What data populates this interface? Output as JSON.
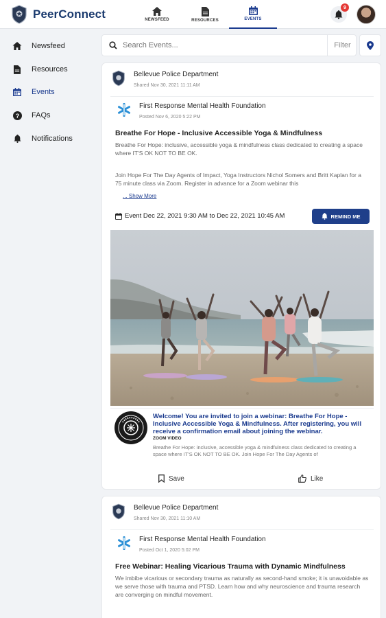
{
  "app": {
    "name": "PeerConnect"
  },
  "topnav": [
    {
      "label": "NEWSFEED",
      "icon": "home-icon",
      "active": false
    },
    {
      "label": "RESOURCES",
      "icon": "file-icon",
      "active": false
    },
    {
      "label": "EVENTS",
      "icon": "calendar-icon",
      "active": true
    }
  ],
  "notifications": {
    "count": "9"
  },
  "sidebar": [
    {
      "label": "Newsfeed",
      "icon": "home-icon"
    },
    {
      "label": "Resources",
      "icon": "file-icon"
    },
    {
      "label": "Events",
      "icon": "calendar-icon",
      "active": true
    },
    {
      "label": "FAQs",
      "icon": "question-circle-icon"
    },
    {
      "label": "Notifications",
      "icon": "bell-icon"
    }
  ],
  "search": {
    "placeholder": "Search Events...",
    "filter_label": "Filter"
  },
  "posts": [
    {
      "sharer": "Bellevue Police Department",
      "shared_date": "Shared Nov 30, 2021 11:11 AM",
      "org": "First Response Mental Health Foundation",
      "posted": "Posted Nov 6, 2020 5:22 PM",
      "title": "Breathe For Hope - Inclusive Accessible Yoga & Mindfulness",
      "desc1": "Breathe For Hope: inclusive, accessible yoga & mindfulness class dedicated to creating a space where IT'S OK NOT TO BE OK.",
      "desc2": "Join Hope For The Day Agents of Impact, Yoga Instructors Nichol Somers and Britt Kaplan for a 75 minute class via Zoom. Register in advance for a Zoom webinar this",
      "show_more": "... Show More",
      "event_date": "Event Dec 22, 2021 9:30 AM to Dec 22, 2021 10:45 AM",
      "remind_label": "REMIND ME",
      "webinar_head": "Welcome! You are invited to join a webinar: Breathe For Hope - Inclusive Accessible Yoga & Mindfulness. After registering, you will receive a confirmation email about joining the webinar.",
      "webinar_source": "ZOOM VIDEO",
      "webinar_desc": "Breathe For Hope: inclusive, accessible yoga & mindfulness class dedicated to creating a space where IT'S OK NOT TO BE OK. Join Hope For The Day Agents of",
      "save_label": "Save",
      "like_label": "Like"
    },
    {
      "sharer": "Bellevue Police Department",
      "shared_date": "Shared Nov 30, 2021 11:10 AM",
      "org": "First Response Mental Health Foundation",
      "posted": "Posted Oct 1, 2020 5:02 PM",
      "title": "Free Webinar: Healing Vicarious Trauma with Dynamic Mindfulness",
      "desc1": "We imbibe vicarious or secondary trauma as naturally as second-hand smoke; it is unavoidable as we serve those with trauma and PTSD. Learn how and why neuroscience and trauma research are converging on mindful movement."
    }
  ],
  "colors": {
    "brand": "#1a3a6e",
    "accent": "#1f3f8a",
    "badge": "#e53935"
  }
}
